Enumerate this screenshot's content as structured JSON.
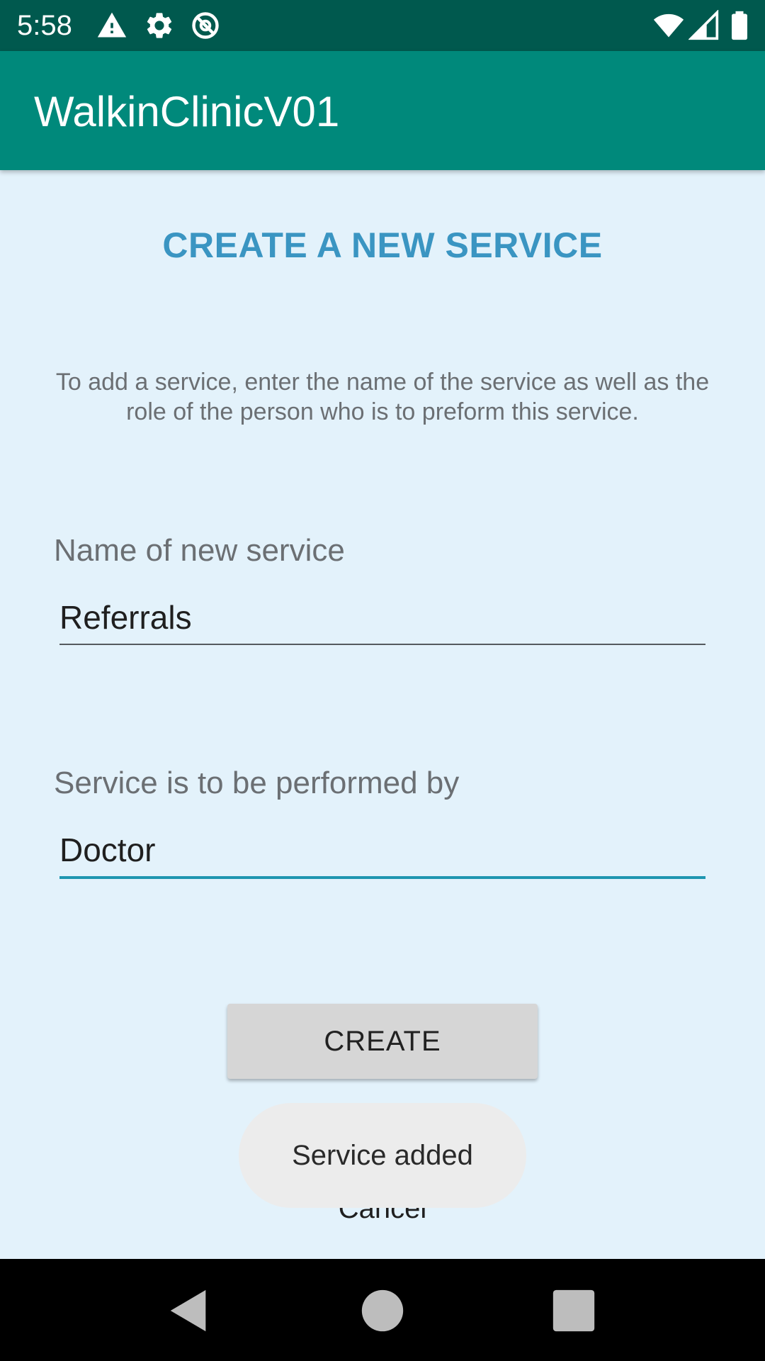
{
  "status_bar": {
    "time": "5:58",
    "left_icons": [
      "warning-icon",
      "settings-icon",
      "sync-disabled-icon"
    ],
    "right_icons": [
      "wifi-icon",
      "signal-icon",
      "battery-icon"
    ]
  },
  "app_bar": {
    "title": "WalkinClinicV01"
  },
  "form": {
    "heading": "CREATE A NEW SERVICE",
    "instructions": "To add a service, enter the name of the service as well as the role of the person who is to preform this service.",
    "service_name": {
      "label": "Name of new service",
      "value": "Referrals"
    },
    "performed_by": {
      "label": "Service is to be performed by",
      "value": "Doctor"
    },
    "create_label": "CREATE",
    "cancel_label": "Cancel"
  },
  "toast": {
    "message": "Service added"
  },
  "nav_bar": {
    "icons": [
      "back-icon",
      "home-icon",
      "recents-icon"
    ]
  },
  "colors": {
    "status_bar": "#00594e",
    "app_bar": "#00897b",
    "background": "#e3f2fb",
    "heading": "#3a95c2",
    "focused_underline": "#1e96b0",
    "button": "#d6d6d6",
    "toast": "#ececec"
  }
}
